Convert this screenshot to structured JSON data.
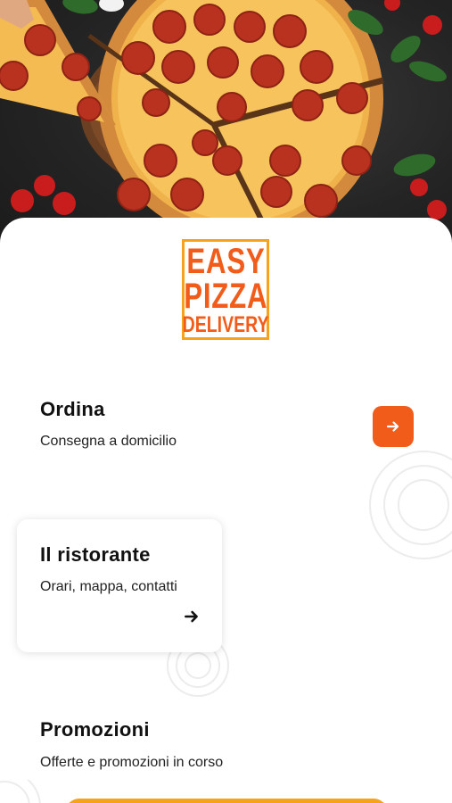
{
  "hero": {
    "image": "pizza-photo"
  },
  "logo": {
    "line1": "EASY",
    "line2": "PIZZA",
    "line3": "DELIVERY"
  },
  "colors": {
    "accent": "#f25c1b",
    "logo_border": "#f6a21a",
    "bottom_button": "#f6a21a"
  },
  "sections": {
    "order": {
      "title": "Ordina",
      "subtitle": "Consegna a domicilio",
      "icon": "arrow-right-icon"
    },
    "restaurant": {
      "title": "Il ristorante",
      "subtitle": "Orari, mappa, contatti",
      "icon": "arrow-right-icon"
    },
    "promotions": {
      "title": "Promozioni",
      "subtitle": "Offerte e promozioni in corso"
    }
  }
}
